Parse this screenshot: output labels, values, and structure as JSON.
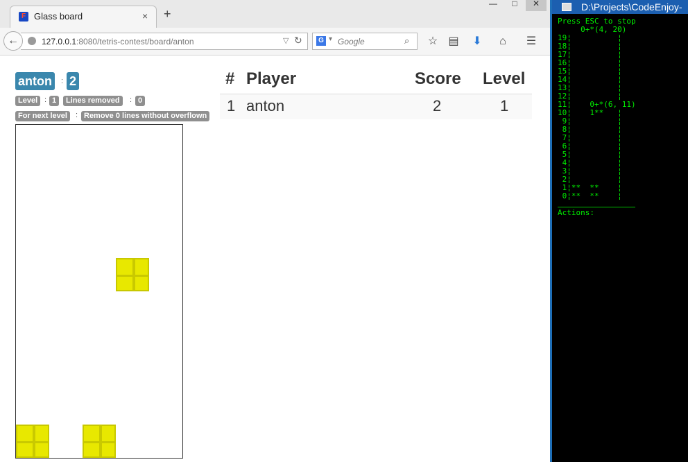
{
  "browser": {
    "tab_title": "Glass board",
    "tab_close": "×",
    "new_tab": "+",
    "win_minimize": "—",
    "win_maximize": "□",
    "win_close": "✕",
    "url_host": "127.0.0.1",
    "url_rest": ":8080/tetris-contest/board/anton",
    "search_engine": "G",
    "search_placeholder": "Google",
    "favicon_letter": "F"
  },
  "player_info": {
    "name": "anton",
    "score": "2",
    "level_label": "Level",
    "level_value": "1",
    "lines_removed_label": "Lines removed",
    "lines_removed_value": "0",
    "next_level_label": "For next level",
    "next_level_value": "Remove 0 lines without overflown",
    "separator": ":"
  },
  "scoreboard": {
    "headers": [
      "#",
      "Player",
      "Score",
      "Level"
    ],
    "rows": [
      {
        "rank": "1",
        "player": "anton",
        "score": "2",
        "level": "1"
      }
    ]
  },
  "glass": {
    "block_color": "#e8e800"
  },
  "console": {
    "title": "D:\\Projects\\CodeEnjoy-",
    "lines": [
      "Press ESC to stop",
      "     0+*(4, 20)",
      "19¦          ¦",
      "18¦          ¦",
      "17¦          ¦",
      "16¦          ¦",
      "15¦          ¦",
      "14¦          ¦",
      "13¦          ¦",
      "12¦          ¦",
      "11¦    0+*(6, 11)",
      "10¦    1**   ¦",
      " 9¦          ¦",
      " 8¦          ¦",
      " 7¦          ¦",
      " 6¦          ¦",
      " 5¦          ¦",
      " 4¦          ¦",
      " 3¦          ¦",
      " 2¦          ¦",
      " 1¦**  **    ¦",
      " 0¦**  **    ¦",
      "",
      "Actions:"
    ],
    "text_color": "#00ee00"
  }
}
